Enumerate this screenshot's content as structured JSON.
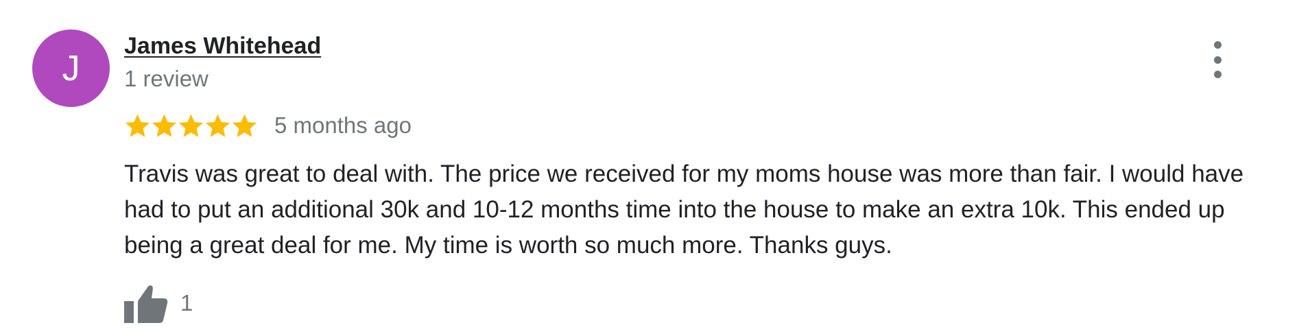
{
  "review": {
    "avatar": {
      "initial": "J",
      "color": "#b049be"
    },
    "reviewer_name": "James Whitehead",
    "review_count": "1 review",
    "rating": 5,
    "rating_max": 5,
    "star_color": "#fbbc04",
    "date": "5 months ago",
    "text": "Travis was great to deal with. The price we received for my moms house was more than fair. I would have had to put an additional 30k and 10-12 months time into the house to make an extra 10k. This ended up being a great deal for me. My time is worth so much more. Thanks guys.",
    "likes": "1",
    "icons": {
      "more": "more-vertical-icon",
      "like": "thumbs-up-icon",
      "star": "star-icon"
    },
    "muted_color": "#70757a"
  }
}
